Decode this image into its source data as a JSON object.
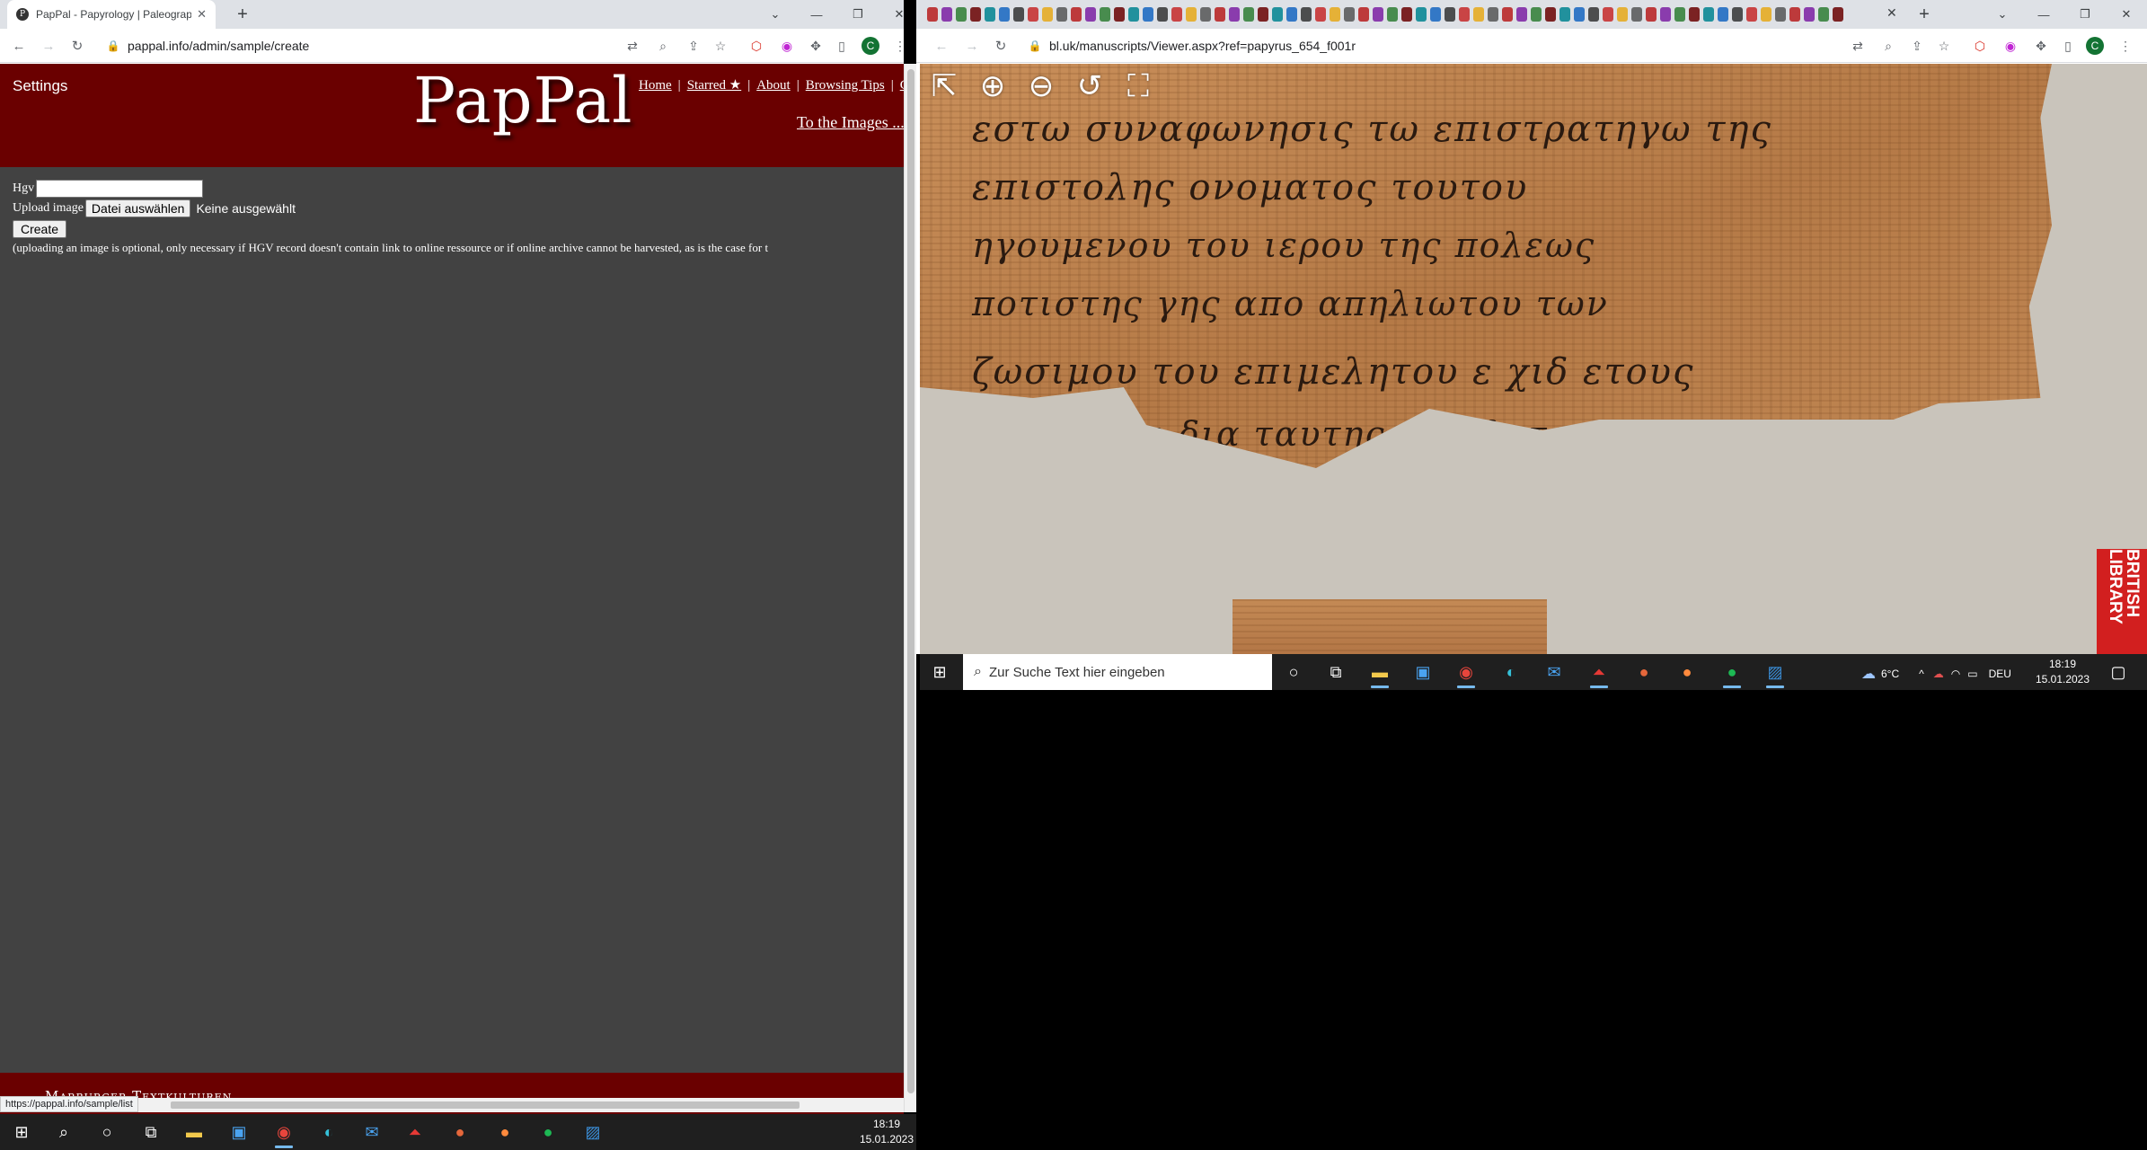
{
  "left_browser": {
    "tab_title": "PapPal - Papyrology | Paleograph",
    "tab_favicon": "P",
    "url": "pappal.info/admin/sample/create",
    "profile_initial": "C"
  },
  "right_browser": {
    "url": "bl.uk/manuscripts/Viewer.aspx?ref=papyrus_654_f001r",
    "profile_initial": "C"
  },
  "pappal": {
    "settings_label": "Settings",
    "logo": "PapPal",
    "nav": [
      "Home",
      "Starred ★",
      "About",
      "Browsing Tips",
      "G"
    ],
    "to_images": "To the Images ...",
    "form": {
      "hgv_label": "Hgv",
      "upload_label": "Upload image",
      "file_button": "Datei auswählen",
      "no_file": "Keine ausgewählt",
      "create_button": "Create",
      "note": "(uploading an image is optional, only necessary if HGV record doesn't contain link to online ressource or if online archive cannot be harvested, as is the case for t"
    },
    "footer_text": "Marburger Textkulturen"
  },
  "status_url": "https://pappal.info/sample/list",
  "viewer": {
    "tools": [
      "exit-icon",
      "zoom-in-icon",
      "zoom-out-icon",
      "rotate-icon",
      "fit-icon"
    ],
    "badge": "BRITISH LIBRARY",
    "script_lines": [
      "εστω συναφωνησις τω επιστρατηγω της",
      "επιστολης     ονοματος τουτου",
      "ηγουμενου του ιερου της πολεως",
      "ποτιστης γης απο απηλιωτου των",
      "ζωσιμου του επιμελητου   ε  χιδ   ετους",
      "χ    ι   τουτου δια ταυτης αφειλετο"
    ]
  },
  "taskbar_left": {
    "time": "18:19",
    "date": "15.01.2023"
  },
  "taskbar_right": {
    "search_placeholder": "Zur Suche Text hier eingeben",
    "weather": "6°C",
    "lang": "DEU",
    "time": "18:19",
    "date": "15.01.2023"
  }
}
